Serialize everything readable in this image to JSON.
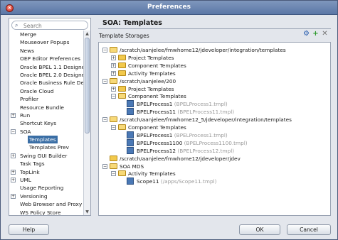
{
  "window": {
    "title": "Preferences",
    "close_icon": "close-icon"
  },
  "search": {
    "placeholder": "Search",
    "icon": "search-icon"
  },
  "nav": [
    {
      "label": "Merge",
      "exp": ""
    },
    {
      "label": "Mouseover Popups",
      "exp": ""
    },
    {
      "label": "News",
      "exp": ""
    },
    {
      "label": "OEP Editor Preferences",
      "exp": ""
    },
    {
      "label": "Oracle BPEL 1.1 Designer",
      "exp": ""
    },
    {
      "label": "Oracle BPEL 2.0 Designer",
      "exp": ""
    },
    {
      "label": "Oracle Business Rule De:",
      "exp": ""
    },
    {
      "label": "Oracle Cloud",
      "exp": ""
    },
    {
      "label": "Profiler",
      "exp": ""
    },
    {
      "label": "Resource Bundle",
      "exp": ""
    },
    {
      "label": "Run",
      "exp": "+"
    },
    {
      "label": "Shortcut Keys",
      "exp": ""
    },
    {
      "label": "SOA",
      "exp": "−"
    },
    {
      "label": "Templates",
      "exp": "",
      "child": true,
      "selected": true
    },
    {
      "label": "Templates Prev",
      "exp": "",
      "child": true
    },
    {
      "label": "Swing GUI Builder",
      "exp": "+"
    },
    {
      "label": "Task Tags",
      "exp": ""
    },
    {
      "label": "TopLink",
      "exp": "+"
    },
    {
      "label": "UML",
      "exp": "+"
    },
    {
      "label": "Usage Reporting",
      "exp": ""
    },
    {
      "label": "Versioning",
      "exp": "+"
    },
    {
      "label": "Web Browser and Proxy",
      "exp": ""
    },
    {
      "label": "WS Policy Store",
      "exp": ""
    }
  ],
  "panel": {
    "title": "SOA: Templates",
    "storages_label": "Template Storages"
  },
  "tree": [
    {
      "level": 0,
      "exp": "−",
      "icon": "folder",
      "label": "/scratch/aanjelee/fmwhome12/jdeveloper/integration/templates",
      "sub": ""
    },
    {
      "level": 1,
      "exp": "+",
      "icon": "folder",
      "label": "Project Templates",
      "sub": ""
    },
    {
      "level": 1,
      "exp": "+",
      "icon": "folder",
      "label": "Component Templates",
      "sub": ""
    },
    {
      "level": 1,
      "exp": "+",
      "icon": "folder",
      "label": "Activity Templates",
      "sub": ""
    },
    {
      "level": 0,
      "exp": "−",
      "icon": "folder",
      "label": "/scratch/aanjelee/200",
      "sub": ""
    },
    {
      "level": 1,
      "exp": "+",
      "icon": "folder",
      "label": "Project Templates",
      "sub": ""
    },
    {
      "level": 1,
      "exp": "−",
      "icon": "folder",
      "label": "Component Templates",
      "sub": ""
    },
    {
      "level": 2,
      "exp": "",
      "icon": "bpel",
      "label": "BPELProcess1",
      "sub": "(BPELProcess1.tmpl)"
    },
    {
      "level": 2,
      "exp": "",
      "icon": "bpel",
      "label": "BPELProcess11",
      "sub": "(BPELProcess11.tmpl)"
    },
    {
      "level": 0,
      "exp": "−",
      "icon": "folder",
      "label": "/scratch/aanjelee/fmwhome12_5/jdeveloper/integration/templates",
      "sub": ""
    },
    {
      "level": 1,
      "exp": "−",
      "icon": "folder",
      "label": "Component Templates",
      "sub": ""
    },
    {
      "level": 2,
      "exp": "",
      "icon": "bpel",
      "label": "BPELProcess1",
      "sub": "(BPELProcess1.tmpl)"
    },
    {
      "level": 2,
      "exp": "",
      "icon": "bpel",
      "label": "BPELProcess1100",
      "sub": "(BPELProcess1100.tmpl)"
    },
    {
      "level": 2,
      "exp": "",
      "icon": "bpel",
      "label": "BPELProcess12",
      "sub": "(BPELProcess12.tmpl)"
    },
    {
      "level": 0,
      "exp": "",
      "icon": "folder",
      "label": "/scratch/aanjelee/fmwhome12/jdeveloper/jdev",
      "sub": ""
    },
    {
      "level": 0,
      "exp": "−",
      "icon": "folder",
      "label": "SOA MDS",
      "sub": ""
    },
    {
      "level": 1,
      "exp": "−",
      "icon": "folder",
      "label": "Activity Templates",
      "sub": ""
    },
    {
      "level": 2,
      "exp": "",
      "icon": "scope",
      "label": "Scope11",
      "sub": "(/apps/Scope11.tmpl)"
    }
  ],
  "buttons": {
    "help": "Help",
    "ok": "OK",
    "cancel": "Cancel"
  }
}
